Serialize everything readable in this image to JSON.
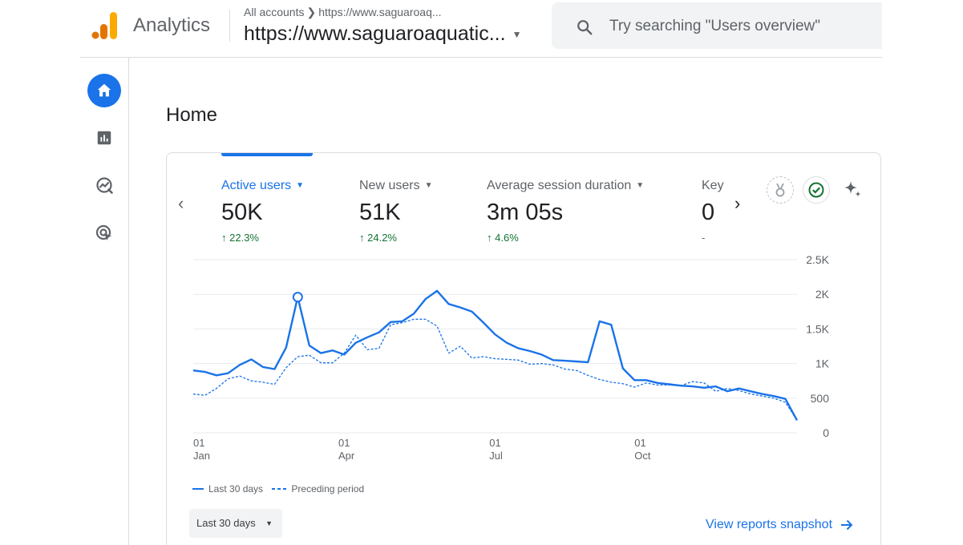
{
  "header": {
    "brand": "Analytics",
    "breadcrumb_label": "All accounts",
    "breadcrumb_account": "https://www.saguaroaq...",
    "property": "https://www.saguaroaquatic...",
    "search_placeholder": "Try searching \"Users overview\""
  },
  "rail": {
    "items": [
      {
        "name": "home-icon",
        "active": true
      },
      {
        "name": "reports-icon",
        "active": false
      },
      {
        "name": "explore-icon",
        "active": false
      },
      {
        "name": "advertising-icon",
        "active": false
      }
    ]
  },
  "page": {
    "title": "Home"
  },
  "metrics": [
    {
      "label": "Active users",
      "value": "50K",
      "change": "22.3%",
      "active": true
    },
    {
      "label": "New users",
      "value": "51K",
      "change": "24.2%",
      "active": false
    },
    {
      "label": "Average session duration",
      "value": "3m 05s",
      "change": "4.6%",
      "active": false
    },
    {
      "label": "Key",
      "value": "0",
      "change": "-",
      "active": false
    }
  ],
  "chart_data": {
    "type": "line",
    "y_ticks": [
      "2.5K",
      "2K",
      "1.5K",
      "1K",
      "500",
      "0"
    ],
    "ylim": [
      0,
      2500
    ],
    "x_ticks": [
      {
        "day": "01",
        "month": "Jan"
      },
      {
        "day": "01",
        "month": "Apr"
      },
      {
        "day": "01",
        "month": "Jul"
      },
      {
        "day": "01",
        "month": "Oct"
      }
    ],
    "grid": true,
    "legend_position": "bottom-left",
    "series": [
      {
        "name": "Last 30 days",
        "style": "solid",
        "values": [
          900,
          880,
          830,
          860,
          980,
          1060,
          950,
          920,
          1230,
          1960,
          1260,
          1150,
          1190,
          1130,
          1300,
          1380,
          1450,
          1600,
          1610,
          1720,
          1930,
          2050,
          1860,
          1810,
          1750,
          1590,
          1420,
          1300,
          1220,
          1180,
          1130,
          1050,
          1040,
          1030,
          1020,
          1610,
          1560,
          930,
          760,
          760,
          720,
          700,
          680,
          670,
          650,
          670,
          600,
          640,
          600,
          560,
          530,
          490,
          180
        ]
      },
      {
        "name": "Preceding period",
        "style": "dashed",
        "values": [
          560,
          540,
          640,
          780,
          820,
          750,
          730,
          700,
          940,
          1100,
          1120,
          1010,
          1010,
          1150,
          1410,
          1200,
          1220,
          1560,
          1590,
          1640,
          1640,
          1540,
          1150,
          1250,
          1080,
          1100,
          1070,
          1060,
          1050,
          990,
          1000,
          980,
          920,
          900,
          830,
          770,
          730,
          710,
          660,
          720,
          690,
          690,
          680,
          740,
          720,
          600,
          640,
          610,
          560,
          530,
          500,
          440,
          180
        ]
      }
    ],
    "highlight_index": 9
  },
  "legend": {
    "current": "Last 30 days",
    "previous": "Preceding period"
  },
  "footer": {
    "range_label": "Last 30 days",
    "view_link": "View reports snapshot"
  }
}
